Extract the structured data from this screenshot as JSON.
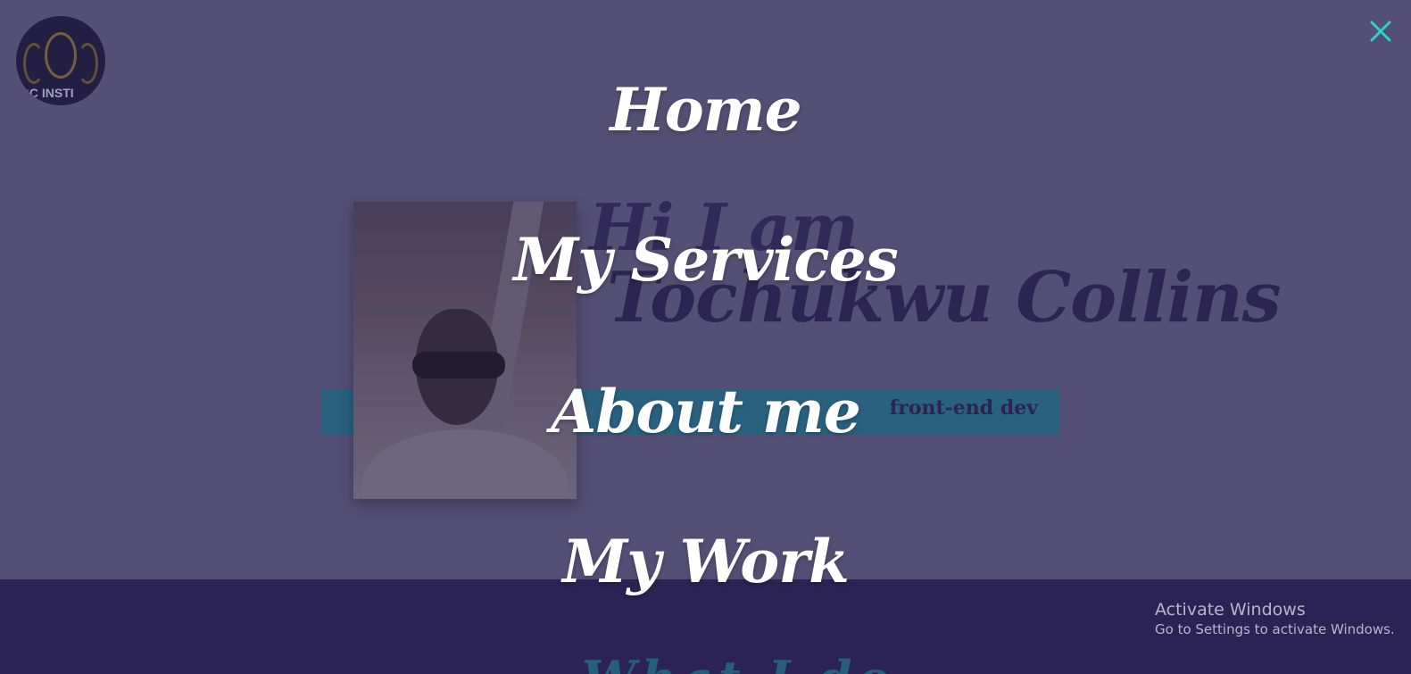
{
  "logo": {
    "text": "OC INSTI"
  },
  "hero": {
    "greeting": "Hi I am",
    "name": "Tochukwu Collins",
    "role": "front-end dev"
  },
  "footer": {
    "peek_text": "What I do"
  },
  "menu": {
    "close_icon": "close-icon",
    "items": [
      {
        "label": "Home"
      },
      {
        "label": "My Services"
      },
      {
        "label": "About me"
      },
      {
        "label": "My Work"
      }
    ]
  },
  "windows_notice": {
    "title": "Activate Windows",
    "subtitle": "Go to Settings to activate Windows."
  },
  "colors": {
    "overlay": "#5a5676",
    "accent_close": "#2fd3c4",
    "band": "#1f6f86",
    "footer": "#221a48"
  }
}
